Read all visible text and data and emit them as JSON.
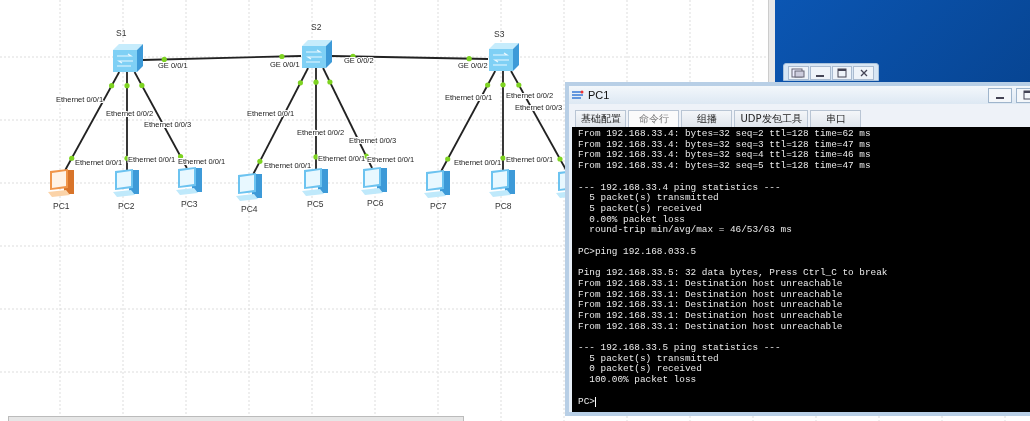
{
  "canvas": {
    "devices": [
      {
        "label": "S1",
        "kind": "switch",
        "highlighted": false
      },
      {
        "label": "S2",
        "kind": "switch",
        "highlighted": false
      },
      {
        "label": "S3",
        "kind": "switch",
        "highlighted": false
      },
      {
        "label": "PC1",
        "kind": "pc",
        "highlighted": true
      },
      {
        "label": "PC2",
        "kind": "pc",
        "highlighted": false
      },
      {
        "label": "PC3",
        "kind": "pc",
        "highlighted": false
      },
      {
        "label": "PC4",
        "kind": "pc",
        "highlighted": false
      },
      {
        "label": "PC5",
        "kind": "pc",
        "highlighted": false
      },
      {
        "label": "PC6",
        "kind": "pc",
        "highlighted": false
      },
      {
        "label": "PC7",
        "kind": "pc",
        "highlighted": false
      },
      {
        "label": "PC8",
        "kind": "pc",
        "highlighted": false
      },
      {
        "kind": "pc",
        "highlighted": false
      }
    ],
    "links": [
      {
        "port_a": "GE 0/0/1",
        "port_b": "GE 0/0/1"
      },
      {
        "port_a": "GE 0/0/2",
        "port_b": "GE 0/0/2"
      },
      {
        "port_a": "Ethernet 0/0/1",
        "port_b": "Ethernet 0/0/1"
      },
      {
        "port_a": "Ethernet 0/0/2",
        "port_b": "Ethernet 0/0/1"
      },
      {
        "port_a": "Ethernet 0/0/3",
        "port_b": "Ethernet 0/0/1"
      },
      {
        "port_a": "Ethernet 0/0/1",
        "port_b": "Ethernet 0/0/1"
      },
      {
        "port_a": "Ethernet 0/0/2",
        "port_b": "Ethernet 0/0/1"
      },
      {
        "port_a": "Ethernet 0/0/3",
        "port_b": "Ethernet 0/0/1"
      },
      {
        "port_a": "Ethernet 0/0/1",
        "port_b": "Ethernet 0/0/1"
      },
      {
        "port_a": "Ethernet 0/0/2",
        "port_b": "Ethernet 0/0/1"
      },
      {
        "port_a": "Ethernet 0/0/3"
      }
    ]
  },
  "window": {
    "title": "PC1",
    "tabs": [
      {
        "label": "基础配置",
        "selected": false
      },
      {
        "label": "命令行",
        "selected": true
      },
      {
        "label": "组播",
        "selected": false
      },
      {
        "label": "UDP发包工具",
        "selected": false
      },
      {
        "label": "串口",
        "selected": false
      }
    ],
    "terminal": {
      "blocks": [
        [
          "From 192.168.33.4: bytes=32 seq=2 ttl=128 time=62 ms",
          "From 192.168.33.4: bytes=32 seq=3 ttl=128 time=47 ms",
          "From 192.168.33.4: bytes=32 seq=4 ttl=128 time=46 ms",
          "From 192.168.33.4: bytes=32 seq=5 ttl=128 time=47 ms"
        ],
        [
          "--- 192.168.33.4 ping statistics ---",
          "  5 packet(s) transmitted",
          "  5 packet(s) received",
          "  0.00% packet loss",
          "  round-trip min/avg/max = 46/53/63 ms"
        ],
        [
          "PC>ping 192.168.033.5"
        ],
        [
          "Ping 192.168.33.5: 32 data bytes, Press Ctrl_C to break",
          "From 192.168.33.1: Destination host unreachable",
          "From 192.168.33.1: Destination host unreachable",
          "From 192.168.33.1: Destination host unreachable",
          "From 192.168.33.1: Destination host unreachable",
          "From 192.168.33.1: Destination host unreachable"
        ],
        [
          "--- 192.168.33.5 ping statistics ---",
          "  5 packet(s) transmitted",
          "  0 packet(s) received",
          "  100.00% packet loss"
        ]
      ],
      "prompt": "PC>",
      "cursor": true
    }
  }
}
